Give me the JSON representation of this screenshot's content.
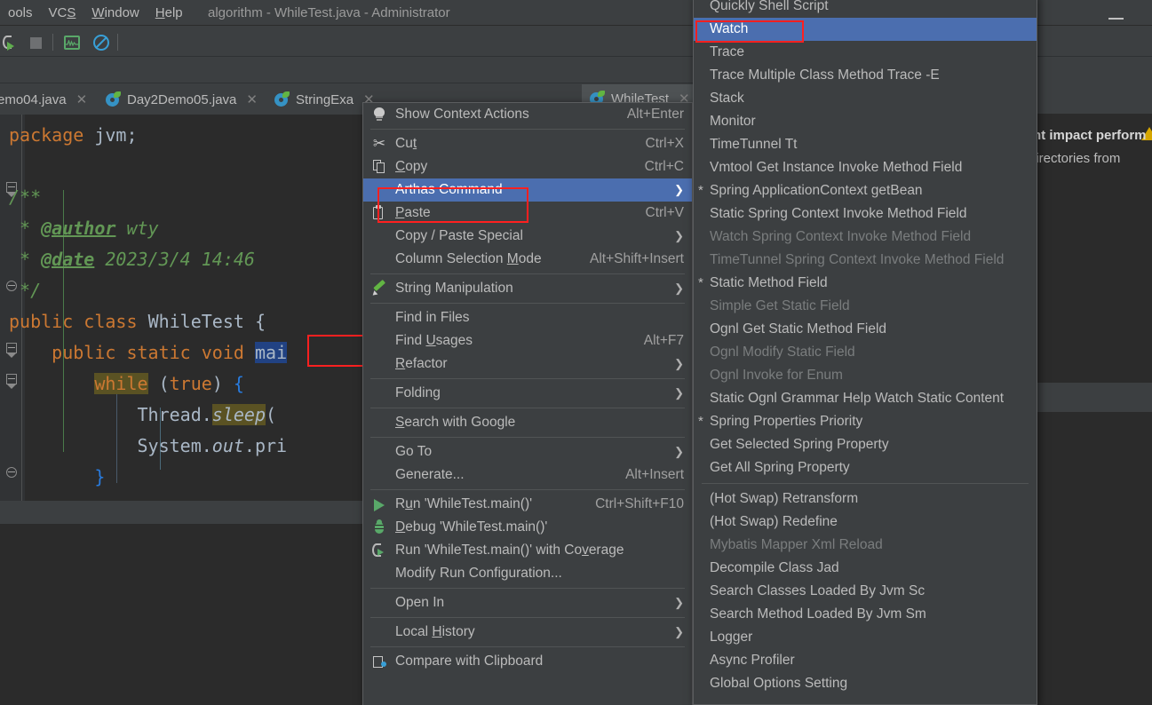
{
  "window": {
    "title": "algorithm - WhileTest.java - Administrator",
    "minimize_label": "Minimize"
  },
  "menubar": {
    "items": [
      {
        "label": "ools",
        "mnemonic": ""
      },
      {
        "label": "VCS",
        "mnemonic": "S"
      },
      {
        "label": "Window",
        "mnemonic": "W"
      },
      {
        "label": "Help",
        "mnemonic": "H"
      }
    ]
  },
  "toolbar": {
    "icons": [
      {
        "name": "run-with-coverage-icon"
      },
      {
        "name": "stop-icon"
      },
      {
        "name": "profiler-monitor-icon"
      },
      {
        "name": "suppress-icon"
      }
    ]
  },
  "tabs": [
    {
      "label": "emo04.java",
      "active": false,
      "close": "✕"
    },
    {
      "label": "Day2Demo05.java",
      "active": false,
      "close": "✕"
    },
    {
      "label": "StringExa",
      "active": false,
      "close": "✕"
    },
    {
      "label": "WhileTest",
      "active": true,
      "close": "✕"
    }
  ],
  "editor": {
    "lines": [
      {
        "tokens": [
          {
            "t": "package",
            "c": "kw"
          },
          {
            "t": " ",
            "c": "pl"
          },
          {
            "t": "jvm",
            "c": "pl"
          },
          {
            "t": ";",
            "c": "pl"
          }
        ]
      },
      {
        "tokens": []
      },
      {
        "tokens": [
          {
            "t": "/**",
            "c": "cmt"
          }
        ]
      },
      {
        "tokens": [
          {
            "t": " * ",
            "c": "cmt"
          },
          {
            "t": "@author",
            "c": "cmt-tag"
          },
          {
            "t": " wty",
            "c": "cmt"
          }
        ]
      },
      {
        "tokens": [
          {
            "t": " * ",
            "c": "cmt"
          },
          {
            "t": "@date",
            "c": "cmt-tag"
          },
          {
            "t": " 2023/3/4 14:46",
            "c": "cmt"
          }
        ]
      },
      {
        "tokens": [
          {
            "t": " */",
            "c": "cmt"
          }
        ]
      },
      {
        "tokens": [
          {
            "t": "public",
            "c": "kw"
          },
          {
            "t": " ",
            "c": "pl"
          },
          {
            "t": "class",
            "c": "kw"
          },
          {
            "t": " ",
            "c": "pl"
          },
          {
            "t": "WhileTest",
            "c": "cls"
          },
          {
            "t": " ",
            "c": "pl"
          },
          {
            "t": "{",
            "c": "brace"
          }
        ]
      },
      {
        "tokens": [
          {
            "t": "    ",
            "c": "pl"
          },
          {
            "t": "public",
            "c": "kw"
          },
          {
            "t": " ",
            "c": "pl"
          },
          {
            "t": "static",
            "c": "kw"
          },
          {
            "t": " ",
            "c": "pl"
          },
          {
            "t": "void",
            "c": "kw"
          },
          {
            "t": " ",
            "c": "pl"
          },
          {
            "t": "mai",
            "c": "sel-blue"
          }
        ]
      },
      {
        "tokens": [
          {
            "t": "        ",
            "c": "pl"
          },
          {
            "t": "while",
            "c": "kw hl-ident"
          },
          {
            "t": " ",
            "c": "pl"
          },
          {
            "t": "(",
            "c": "brace"
          },
          {
            "t": "true",
            "c": "kw"
          },
          {
            "t": ")",
            "c": "brace"
          },
          {
            "t": " ",
            "c": "pl"
          },
          {
            "t": "{",
            "c": "brace-b"
          }
        ]
      },
      {
        "tokens": [
          {
            "t": "            ",
            "c": "pl"
          },
          {
            "t": "Thread",
            "c": "cls"
          },
          {
            "t": ".",
            "c": "pl"
          },
          {
            "t": "sleep",
            "c": "stat hl-ident"
          },
          {
            "t": "(",
            "c": "brace"
          }
        ]
      },
      {
        "tokens": [
          {
            "t": "            ",
            "c": "pl"
          },
          {
            "t": "System",
            "c": "cls"
          },
          {
            "t": ".",
            "c": "pl"
          },
          {
            "t": "out",
            "c": "stat"
          },
          {
            "t": ".",
            "c": "pl"
          },
          {
            "t": "pri",
            "c": "pl"
          }
        ]
      },
      {
        "tokens": [
          {
            "t": "        ",
            "c": "pl"
          },
          {
            "t": "}",
            "c": "brace-b"
          }
        ]
      }
    ]
  },
  "context_menu": {
    "items": [
      {
        "label": "Show Context Actions",
        "shortcut": "Alt+Enter",
        "icon": "lightbulb-icon",
        "type": "item"
      },
      {
        "type": "separator"
      },
      {
        "label": "Cu<u>t</u>",
        "shortcut": "Ctrl+X",
        "icon": "scissors-icon",
        "type": "item"
      },
      {
        "label": "<u>C</u>opy",
        "shortcut": "Ctrl+C",
        "icon": "copy-icon",
        "type": "item"
      },
      {
        "label": "Arthas Command",
        "shortcut": "",
        "submenu": true,
        "selected": true,
        "icon": "",
        "type": "item"
      },
      {
        "label": "<u>P</u>aste",
        "shortcut": "Ctrl+V",
        "icon": "paste-icon",
        "type": "item"
      },
      {
        "label": "Copy / Paste Special",
        "shortcut": "",
        "submenu": true,
        "icon": "",
        "type": "item"
      },
      {
        "label": "Column Selection <u>M</u>ode",
        "shortcut": "Alt+Shift+Insert",
        "icon": "",
        "type": "item"
      },
      {
        "type": "separator"
      },
      {
        "label": "String Manipulation",
        "shortcut": "",
        "submenu": true,
        "icon": "pencil-icon",
        "type": "item"
      },
      {
        "type": "separator"
      },
      {
        "label": "Find in Files",
        "shortcut": "",
        "icon": "",
        "type": "item"
      },
      {
        "label": "Find <u>U</u>sages",
        "shortcut": "Alt+F7",
        "icon": "",
        "type": "item"
      },
      {
        "label": "<u>R</u>efactor",
        "shortcut": "",
        "submenu": true,
        "icon": "",
        "type": "item"
      },
      {
        "type": "separator"
      },
      {
        "label": "Folding",
        "shortcut": "",
        "submenu": true,
        "icon": "",
        "type": "item"
      },
      {
        "type": "separator"
      },
      {
        "label": "<u>S</u>earch with Google",
        "shortcut": "",
        "icon": "",
        "type": "item"
      },
      {
        "type": "separator"
      },
      {
        "label": "Go To",
        "shortcut": "",
        "submenu": true,
        "icon": "",
        "type": "item"
      },
      {
        "label": "Generate...",
        "shortcut": "Alt+Insert",
        "icon": "",
        "type": "item"
      },
      {
        "type": "separator"
      },
      {
        "label": "R<u>u</u>n 'WhileTest.main()'",
        "shortcut": "Ctrl+Shift+F10",
        "icon": "run-icon",
        "type": "item"
      },
      {
        "label": "<u>D</u>ebug 'WhileTest.main()'",
        "shortcut": "",
        "icon": "debug-icon",
        "type": "item"
      },
      {
        "label": "Run 'WhileTest.main()' with Co<u>v</u>erage",
        "shortcut": "",
        "icon": "run-coverage-icon",
        "type": "item"
      },
      {
        "label": "Modify Run Configuration...",
        "shortcut": "",
        "icon": "",
        "type": "item"
      },
      {
        "type": "separator"
      },
      {
        "label": "Open In",
        "shortcut": "",
        "submenu": true,
        "icon": "",
        "type": "item"
      },
      {
        "type": "separator"
      },
      {
        "label": "Local <u>H</u>istory",
        "shortcut": "",
        "submenu": true,
        "icon": "",
        "type": "item"
      },
      {
        "type": "separator"
      },
      {
        "label": "Compare with Clipboard",
        "shortcut": "",
        "icon": "clipboard-compare-icon",
        "type": "item"
      }
    ]
  },
  "arthas_submenu": {
    "items": [
      {
        "label": "Quickly Shell Script",
        "type": "item"
      },
      {
        "label": "Watch",
        "type": "item",
        "selected": true
      },
      {
        "label": "Trace",
        "type": "item"
      },
      {
        "label": "Trace Multiple Class Method Trace -E",
        "type": "item"
      },
      {
        "label": "Stack",
        "type": "item"
      },
      {
        "label": "Monitor",
        "type": "item"
      },
      {
        "label": "TimeTunnel Tt",
        "type": "item"
      },
      {
        "label": "Vmtool Get Instance Invoke Method Field",
        "type": "item"
      },
      {
        "label": "Spring ApplicationContext getBean",
        "type": "item",
        "star": "*"
      },
      {
        "label": "Static Spring Context Invoke  Method Field",
        "type": "item"
      },
      {
        "label": "Watch Spring Context Invoke Method Field",
        "type": "item",
        "disabled": true
      },
      {
        "label": "TimeTunnel Spring Context Invoke Method Field",
        "type": "item",
        "disabled": true
      },
      {
        "label": "Static Method Field",
        "type": "item",
        "star": "*"
      },
      {
        "label": "Simple Get Static Field",
        "type": "item",
        "disabled": true
      },
      {
        "label": "Ognl Get Static Method Field",
        "type": "item"
      },
      {
        "label": "Ognl Modify Static Field",
        "type": "item",
        "disabled": true
      },
      {
        "label": "Ognl Invoke for Enum",
        "type": "item",
        "disabled": true
      },
      {
        "label": "Static Ognl Grammar Help Watch Static Content",
        "type": "item"
      },
      {
        "label": "Spring Properties Priority",
        "type": "item",
        "star": "*"
      },
      {
        "label": "Get Selected Spring Property",
        "type": "item"
      },
      {
        "label": "Get All Spring Property",
        "type": "item"
      },
      {
        "type": "separator"
      },
      {
        "label": "(Hot Swap) Retransform",
        "type": "item"
      },
      {
        "label": "(Hot Swap) Redefine",
        "type": "item"
      },
      {
        "label": "Mybatis Mapper Xml Reload",
        "type": "item",
        "disabled": true
      },
      {
        "label": "Decompile Class Jad",
        "type": "item"
      },
      {
        "label": "Search Classes Loaded By Jvm Sc",
        "type": "item"
      },
      {
        "label": "Search Method Loaded By Jvm Sm",
        "type": "item"
      },
      {
        "label": "Logger",
        "type": "item"
      },
      {
        "label": "Async Profiler",
        "type": "item"
      },
      {
        "label": "Global Options Setting",
        "type": "item"
      }
    ]
  },
  "bottom_panel": {
    "tip_bold": "nt impact perform",
    "tip_rest": "lirectories from"
  },
  "colors": {
    "menu_bg": "#3c3f41",
    "selection_blue": "#4b6eaf",
    "editor_bg": "#2b2b2b",
    "highlight_red": "#ff2020",
    "keyword_orange": "#cc7832",
    "comment_green": "#629755",
    "text_grey": "#bbbbbb"
  }
}
